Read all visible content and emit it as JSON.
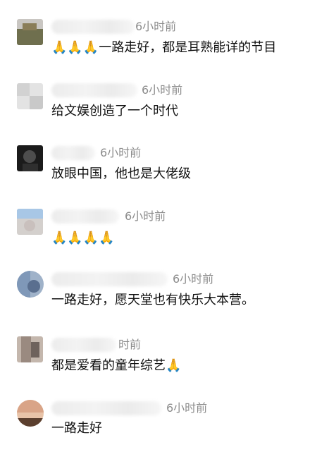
{
  "comments": [
    {
      "time": "6小时前",
      "text": "🙏🙏🙏一路走好，都是耳熟能详的节目",
      "avatar_colors": [
        "#6f6f4e",
        "#c9c6c2",
        "#8a7d58"
      ]
    },
    {
      "time": "6小时前",
      "text": "给文娱创造了一个时代",
      "avatar_colors": [
        "#dcdcdc",
        "#c4c4c4",
        "#e9e9e9"
      ]
    },
    {
      "time": "6小时前",
      "text": "放眼中国，他也是大佬级",
      "avatar_colors": [
        "#1b1b1b",
        "#4d4d4d",
        "#2a2a2a"
      ]
    },
    {
      "time": "6小时前",
      "text": "🙏🙏🙏🙏",
      "avatar_colors": [
        "#a8c7e6",
        "#c9c0bd",
        "#bfcfe0"
      ]
    },
    {
      "time": "6小时前",
      "text": "一路走好，愿天堂也有快乐大本营。",
      "avatar_colors": [
        "#7f98b8",
        "#5a6f8f",
        "#9fb2c9"
      ]
    },
    {
      "time": "时前",
      "text": "都是爱看的童年综艺🙏",
      "avatar_colors": [
        "#9a8a80",
        "#6e625c",
        "#c4b7ad"
      ]
    },
    {
      "time": "6小时前",
      "text": "一路走好",
      "avatar_colors": [
        "#d9a487",
        "#5b3f2e",
        "#e8c3a8"
      ]
    }
  ]
}
